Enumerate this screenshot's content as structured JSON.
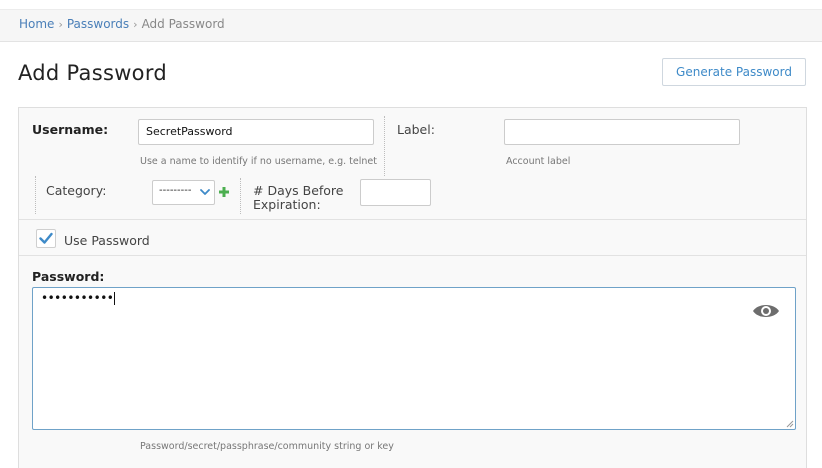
{
  "breadcrumb": {
    "home": "Home",
    "separator": "›",
    "passwords": "Passwords",
    "current": "Add Password"
  },
  "page": {
    "title": "Add Password",
    "generate_button": "Generate Password"
  },
  "form": {
    "username": {
      "label": "Username:",
      "value": "SecretPassword",
      "help": "Use a name to identify if no username, e.g. telnet"
    },
    "label_field": {
      "label": "Label:",
      "value": "",
      "help": "Account label"
    },
    "category": {
      "label": "Category:",
      "selected": "---------"
    },
    "days_before_expiration": {
      "label_line1": "# Days Before",
      "label_line2": "Expiration:",
      "value": ""
    },
    "use_password": {
      "label": "Use Password",
      "checked": true
    },
    "password": {
      "label": "Password:",
      "masked_value": "•••••••••••",
      "help": "Password/secret/passphrase/community string or key"
    }
  },
  "icons": {
    "chevron": "chevron-down-icon",
    "add": "plus-icon",
    "eye": "eye-icon",
    "check": "checkmark-icon"
  },
  "colors": {
    "link": "#4a7fb8",
    "accent": "#3e8ac8",
    "add_green": "#4caf50",
    "focus_border": "#6fa2c8"
  }
}
